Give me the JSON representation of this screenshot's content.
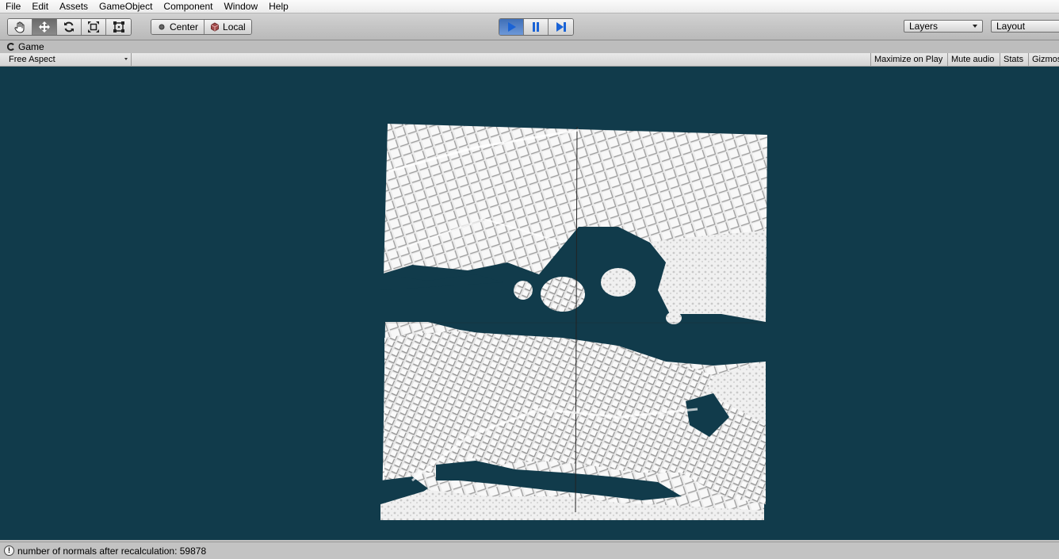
{
  "menu": {
    "items": [
      "File",
      "Edit",
      "Assets",
      "GameObject",
      "Component",
      "Window",
      "Help"
    ]
  },
  "toolbar": {
    "transform_tools": [
      "hand-tool",
      "move-tool",
      "rotate-tool",
      "scale-tool",
      "rect-tool"
    ],
    "pivot_label": "Center",
    "space_label": "Local",
    "layers_label": "Layers",
    "layout_label": "Layout"
  },
  "game_view": {
    "tab_label": "Game",
    "aspect_label": "Free Aspect",
    "maximize_label": "Maximize on Play",
    "mute_label": "Mute audio",
    "stats_label": "Stats",
    "gizmos_label": "Gizmos",
    "background_color": "#113b4b"
  },
  "status": {
    "message": "number of normals after recalculation: 59878",
    "icon": "info-icon"
  }
}
